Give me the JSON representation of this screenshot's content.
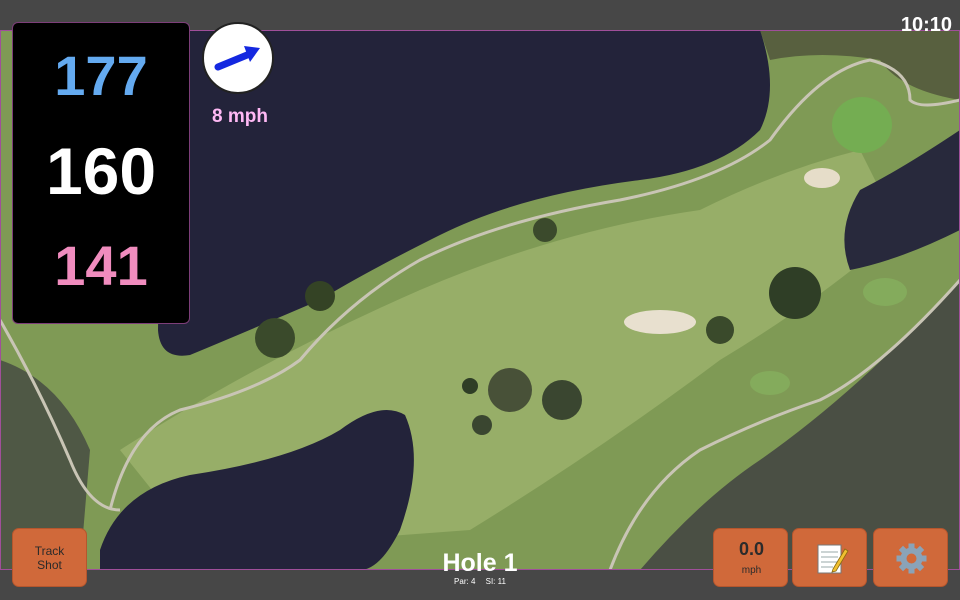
{
  "status": {
    "time": "10:10"
  },
  "distances": {
    "back": "177",
    "middle": "160",
    "front": "141"
  },
  "wind": {
    "speed": "8 mph",
    "icon": "wind-arrow-icon"
  },
  "buttons": {
    "track_shot": [
      "Track",
      "Shot"
    ],
    "speed_value": "0.0",
    "speed_unit": "mph",
    "notes_icon": "notepad-icon",
    "settings_icon": "gear-icon"
  },
  "hole": {
    "title": "Hole 1",
    "par": "Par: 4",
    "si": "SI: 11"
  },
  "colors": {
    "back": "#64aaf0",
    "middle": "#ffffff",
    "front": "#f08cbe",
    "wind_text": "#ffb9f5",
    "button": "#d0693a",
    "frame": "#a04f9a"
  }
}
